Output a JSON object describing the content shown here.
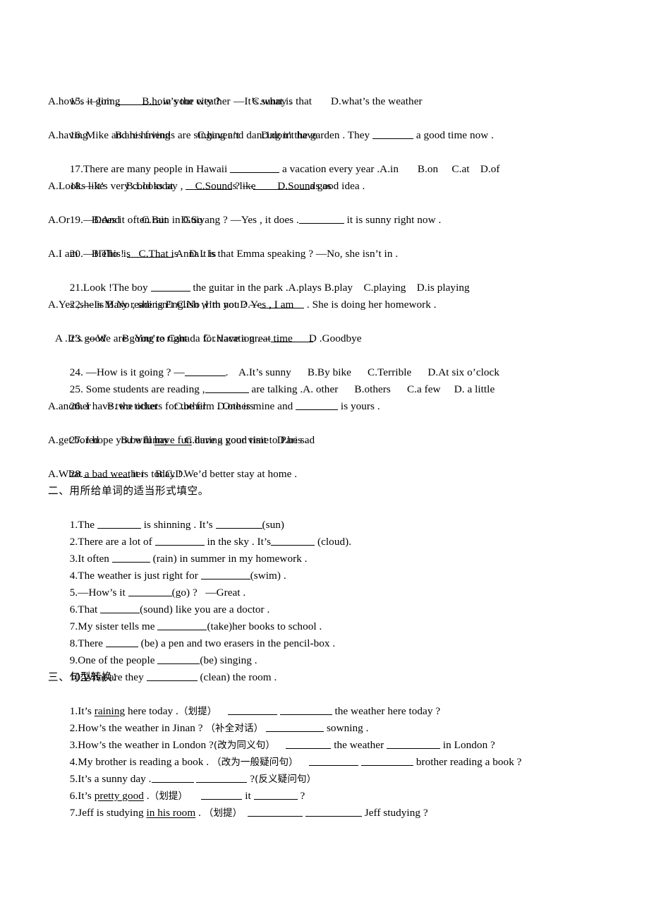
{
  "document": {
    "type": "worksheet",
    "language_mix": "English with Chinese instructions"
  },
  "section1": {
    "items": [
      {
        "id": "q15",
        "stem_a": "15. —Jim ,",
        "blank1": 60,
        "stem_b": " in your city ?     —It’s sunny .",
        "options": "A.how’s it going        B.how’s the weather        C.what is that       D.what’s the weather"
      },
      {
        "id": "q16",
        "stem_a": "16. Mike and his friends are singing and dancing in the garden . They ",
        "blank1": 58,
        "stem_b": " a good time now .",
        "options": "A.having          B.are having          C.haven’t        D.don’t have"
      },
      {
        "id": "q17",
        "stem_a": "17.There are many people in Hawaii ",
        "blank1": 70,
        "stem_b": " a vacation every year .A.in       B.on     C.at    D.of"
      },
      {
        "id": "q18",
        "stem_a": "18.—It’s very cold today , ",
        "blank1": 66,
        "stem_b": " ? —",
        "blank2": 80,
        "stem_c": "a good idea .",
        "options": "A.Looks like        B.Looks at        C.Sounds like        D.Sounds as"
      },
      {
        "id": "q19",
        "stem_a": "19.—Does it often rain in Guiyang ? —Yes , it does .",
        "blank1": 64,
        "stem_b": " it is sunny right now .",
        "options": "A.Or        B.And        C.But     D.So"
      },
      {
        "id": "q20",
        "stem_a": "20.—Hello ! ",
        "blank1": 66,
        "stem_b": " Anna . Is that Emma speaking ? —No, she isn’t in .",
        "options": "A.I am     B.This is   C.That is    D.It is"
      },
      {
        "id": "q21",
        "stem_a": "21.Look !The boy ",
        "blank1": 56,
        "stem_b": " the guitar in the park .A.plays B.play    C.playing    D.is playing"
      },
      {
        "id": "q22",
        "stem_a": "22.—Is Mary reading English with you ? —",
        "blank1": 62,
        "stem_b": " . She is doing her homework .",
        "options": "A.Yes ,she is B.No , she isn’t C.No ,I’m not D.Yes , I am"
      },
      {
        "id": "q23",
        "stem_a": "23. —We are going to Canada for vacation .—",
        "blank1": 60,
        "stem_b": "     .",
        "options": "A .It’s good      B .You’re right      C .Have a great time      D .Goodbye"
      },
      {
        "id": "q24",
        "stem_a": "24. —How is it going ? —",
        "blank1": 58,
        "stem_b": ".    A.It’s sunny      B.By bike      C.Terrible      D.At six o’clock"
      },
      {
        "id": "q25",
        "stem_a": "25. Some students are reading ,",
        "blank1": 62,
        "stem_b": " are talking .A. other      B.others      C.a few     D. a little"
      },
      {
        "id": "q26",
        "stem_a": "26. I have two tickets for the film . One is mine and ",
        "blank1": 60,
        "stem_b": " is yours .",
        "options": "A.another      B. the other      C.other    D.others"
      },
      {
        "id": "q27",
        "stem_pre": "27. I hope you will ",
        "underlined": "have fun",
        "stem_post": " during your visit to Paris .",
        "options": "A.get bored        B.be funny      C.have a good time   D.be sad"
      },
      {
        "id": "q28",
        "stem_a": "28.",
        "blank1": 66,
        "stem_b": " it is today ! We’d better stay at home .",
        "options": "A.What a bad weather    B.C.D."
      }
    ]
  },
  "section2": {
    "heading": "二、用所给单词的适当形式填空。",
    "items": [
      {
        "id": "s2q1",
        "a": "1.The ",
        "b1": 62,
        "b": " is shinning . It’s ",
        "b2": 66,
        "c": "(sun)"
      },
      {
        "id": "s2q2",
        "a": "2.There are a lot of ",
        "b1": 70,
        "b": " in the sky . It’s",
        "b2": 62,
        "c": " (cloud)."
      },
      {
        "id": "s2q3",
        "a": "3.It often ",
        "b1": 54,
        "b": " (rain) in summer in my homework ."
      },
      {
        "id": "s2q4",
        "a": "4.The weather is just right for ",
        "b1": 70,
        "b": "(swim) ."
      },
      {
        "id": "s2q5",
        "a": "5.—How’s it ",
        "b1": 62,
        "b": "(go) ?   —Great ."
      },
      {
        "id": "s2q6",
        "a": "6.That ",
        "b1": 56,
        "b": "(sound) like you are a doctor ."
      },
      {
        "id": "s2q7",
        "a": "7.My sister tells me ",
        "b1": 70,
        "b": "(take)her books to school ."
      },
      {
        "id": "s2q8",
        "a": "8.There ",
        "b1": 46,
        "b": " (be) a pen and two erasers in the pencil-box ."
      },
      {
        "id": "s2q9",
        "a": "9.One of the people ",
        "b1": 60,
        "b": "(be) singing ."
      },
      {
        "id": "s2q10",
        "a": "10.What are they ",
        "b1": 72,
        "b": " (clean) the room ."
      }
    ]
  },
  "section3": {
    "heading": "三、句型转换：",
    "items": [
      {
        "id": "s3q1",
        "pre": "1.It’s ",
        "underlined": "raining",
        "post": " here today .",
        "note": "（划提）",
        "after_note": "    ",
        "b1": 70,
        "mid": " ",
        "b2": 74,
        "tail": " the weather here today ?"
      },
      {
        "id": "s3q2",
        "pre": "2.How’s the weather in Jinan ? ",
        "note": "（补全对话）",
        "after_note": " ",
        "b1": 82,
        "tail": " sowning ."
      },
      {
        "id": "s3q3",
        "pre": "3.How’s the weather in London ?",
        "note": "(改为同义句）",
        "after_note": "    ",
        "b1": 64,
        "mid": " the weather ",
        "b2": 76,
        "tail": " in London ?"
      },
      {
        "id": "s3q4",
        "pre": "4.My brother is reading a book . ",
        "note": "（改为一般疑问句）",
        "after_note": "    ",
        "b1": 70,
        "mid": " ",
        "b2": 74,
        "tail": " brother reading a book ?"
      },
      {
        "id": "s3q5",
        "pre": "5.It’s a sunny day .",
        "b1": 60,
        "mid": " ",
        "b2": 72,
        "tail": " ?",
        "note": "(反义疑问句）"
      },
      {
        "id": "s3q6",
        "pre": "6.It’s ",
        "underlined": "pretty good",
        "post": " .",
        "note": "（划提）",
        "after_note": "     ",
        "b1": 58,
        "mid": " it ",
        "b2": 62,
        "tail": " ?"
      },
      {
        "id": "s3q7",
        "pre": "7.Jeff is studying ",
        "underlined": "in his room",
        "post": " . ",
        "note": "（划提）",
        "after_note": "  ",
        "b1": 78,
        "mid": " ",
        "b2": 80,
        "tail": " Jeff studying ?"
      }
    ]
  }
}
